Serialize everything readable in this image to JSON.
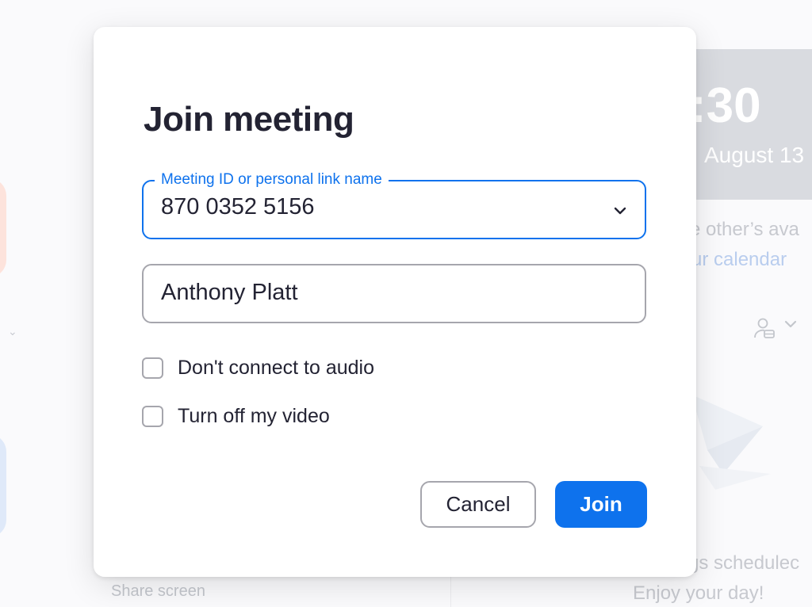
{
  "background": {
    "share_screen_label": "Share screen",
    "clock_time": ":30",
    "clock_date": "August 13",
    "availability_text": "e other’s ava",
    "calendar_link": "ur calendar",
    "scheduled_text": "gs schedulec",
    "enjoy_text": "Enjoy your day!"
  },
  "dialog": {
    "title": "Join meeting",
    "meeting_field": {
      "label": "Meeting ID or personal link name",
      "value": "870 0352 5156",
      "icon": "chevron-down-icon"
    },
    "name_field": {
      "value": "Anthony Platt"
    },
    "options": [
      {
        "label": "Don't connect to audio",
        "checked": false
      },
      {
        "label": "Turn off my video",
        "checked": false
      }
    ],
    "buttons": {
      "cancel": "Cancel",
      "join": "Join"
    }
  },
  "colors": {
    "accent": "#0e72ed",
    "text": "#232333",
    "border": "#a6a6ad"
  }
}
